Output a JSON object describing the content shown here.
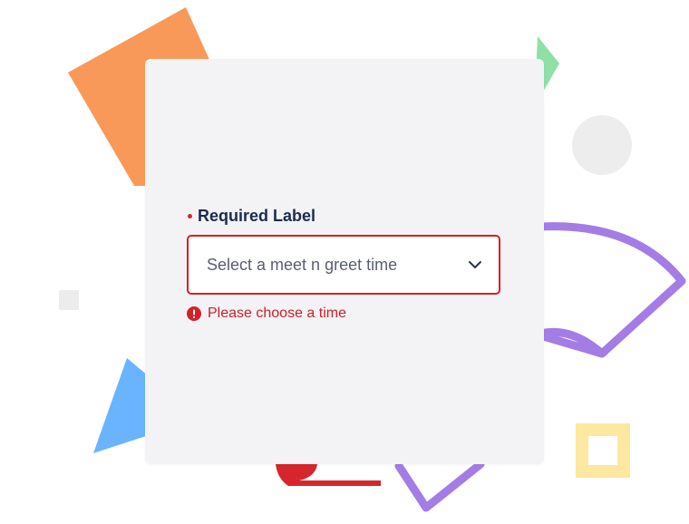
{
  "form": {
    "required_label": "Required Label",
    "select": {
      "value": "Select a meet n greet time"
    },
    "error_message": "Please choose a time"
  },
  "colors": {
    "card_background": "#f3f3f5",
    "label": "#1d2b4f",
    "error": "#d3212b",
    "select_text": "#5a5f6e"
  },
  "icons": {
    "required": "required-dot-icon",
    "chevron": "chevron-down-icon",
    "error": "error-alert-icon"
  }
}
